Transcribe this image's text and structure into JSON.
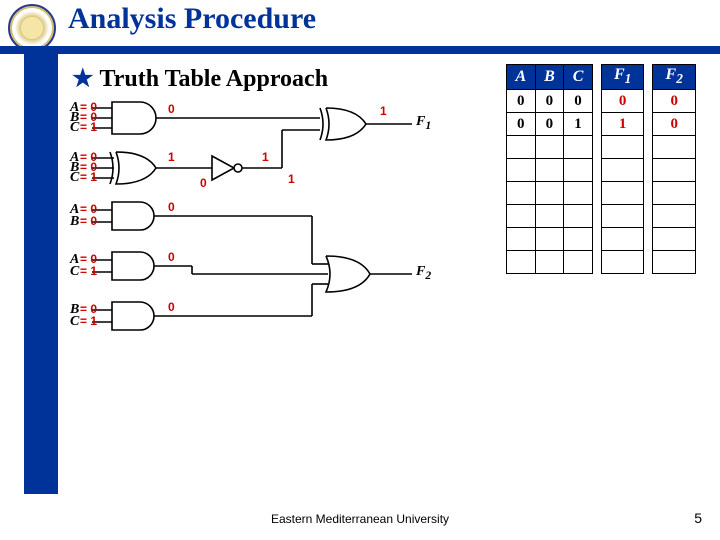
{
  "title": "Analysis Procedure",
  "section": "Truth Table Approach",
  "footer": "Eastern Mediterranean University",
  "page": "5",
  "gate_inputs": {
    "g1": {
      "A": "= 0",
      "B": "= 0",
      "C": "= 1",
      "out": "0"
    },
    "g2": {
      "A": "= 0",
      "B": "= 0",
      "C": "= 1",
      "out": "1"
    },
    "g3": {
      "A": "= 0",
      "B": "= 0",
      "out": "0"
    },
    "g4": {
      "A": "= 0",
      "C": "= 1",
      "out": "0"
    },
    "g5": {
      "B": "= 0",
      "C": "= 1",
      "out": "0"
    },
    "xor_out": "1",
    "not_out": "1",
    "not_post": "0",
    "F1_wire": "1",
    "F1": "F",
    "F1sub": "1",
    "F2": "F",
    "F2sub": "2"
  },
  "truth_table": {
    "headers": [
      "A",
      "B",
      "C",
      "F1",
      "F2"
    ],
    "rows": [
      {
        "A": "0",
        "B": "0",
        "C": "0",
        "F1": "0",
        "F2": "0"
      },
      {
        "A": "0",
        "B": "0",
        "C": "1",
        "F1": "1",
        "F2": "0"
      }
    ],
    "blank_rows": 6
  },
  "chart_data": {
    "type": "table",
    "title": "Truth Table Approach",
    "columns": [
      "A",
      "B",
      "C",
      "F1",
      "F2"
    ],
    "rows": [
      [
        0,
        0,
        0,
        0,
        0
      ],
      [
        0,
        0,
        1,
        1,
        0
      ]
    ],
    "total_rows": 8,
    "circuit": {
      "gates": [
        {
          "id": "G1",
          "type": "AND3",
          "inputs": [
            "A",
            "B",
            "C"
          ],
          "values": [
            0,
            0,
            1
          ],
          "out": 0
        },
        {
          "id": "G2",
          "type": "XOR3",
          "inputs": [
            "A",
            "B",
            "C"
          ],
          "values": [
            0,
            0,
            1
          ],
          "out": 1
        },
        {
          "id": "G3",
          "type": "AND2",
          "inputs": [
            "A",
            "B"
          ],
          "values": [
            0,
            0
          ],
          "out": 0
        },
        {
          "id": "G4",
          "type": "AND2",
          "inputs": [
            "A",
            "C"
          ],
          "values": [
            0,
            1
          ],
          "out": 0
        },
        {
          "id": "G5",
          "type": "AND2",
          "inputs": [
            "B",
            "C"
          ],
          "values": [
            0,
            1
          ],
          "out": 0
        },
        {
          "id": "NOT",
          "type": "NOT",
          "input": "G2.out",
          "in_value": 1,
          "out": 1
        },
        {
          "id": "XOR_TOP",
          "type": "XOR2",
          "inputs": [
            "G1.out",
            "NOT.out"
          ],
          "out": 1,
          "drives": "F1"
        },
        {
          "id": "OR_BOT",
          "type": "OR3",
          "inputs": [
            "G3.out",
            "G4.out",
            "G5.out"
          ],
          "drives": "F2"
        }
      ],
      "outputs": {
        "F1": 1,
        "F2": 0
      }
    }
  }
}
